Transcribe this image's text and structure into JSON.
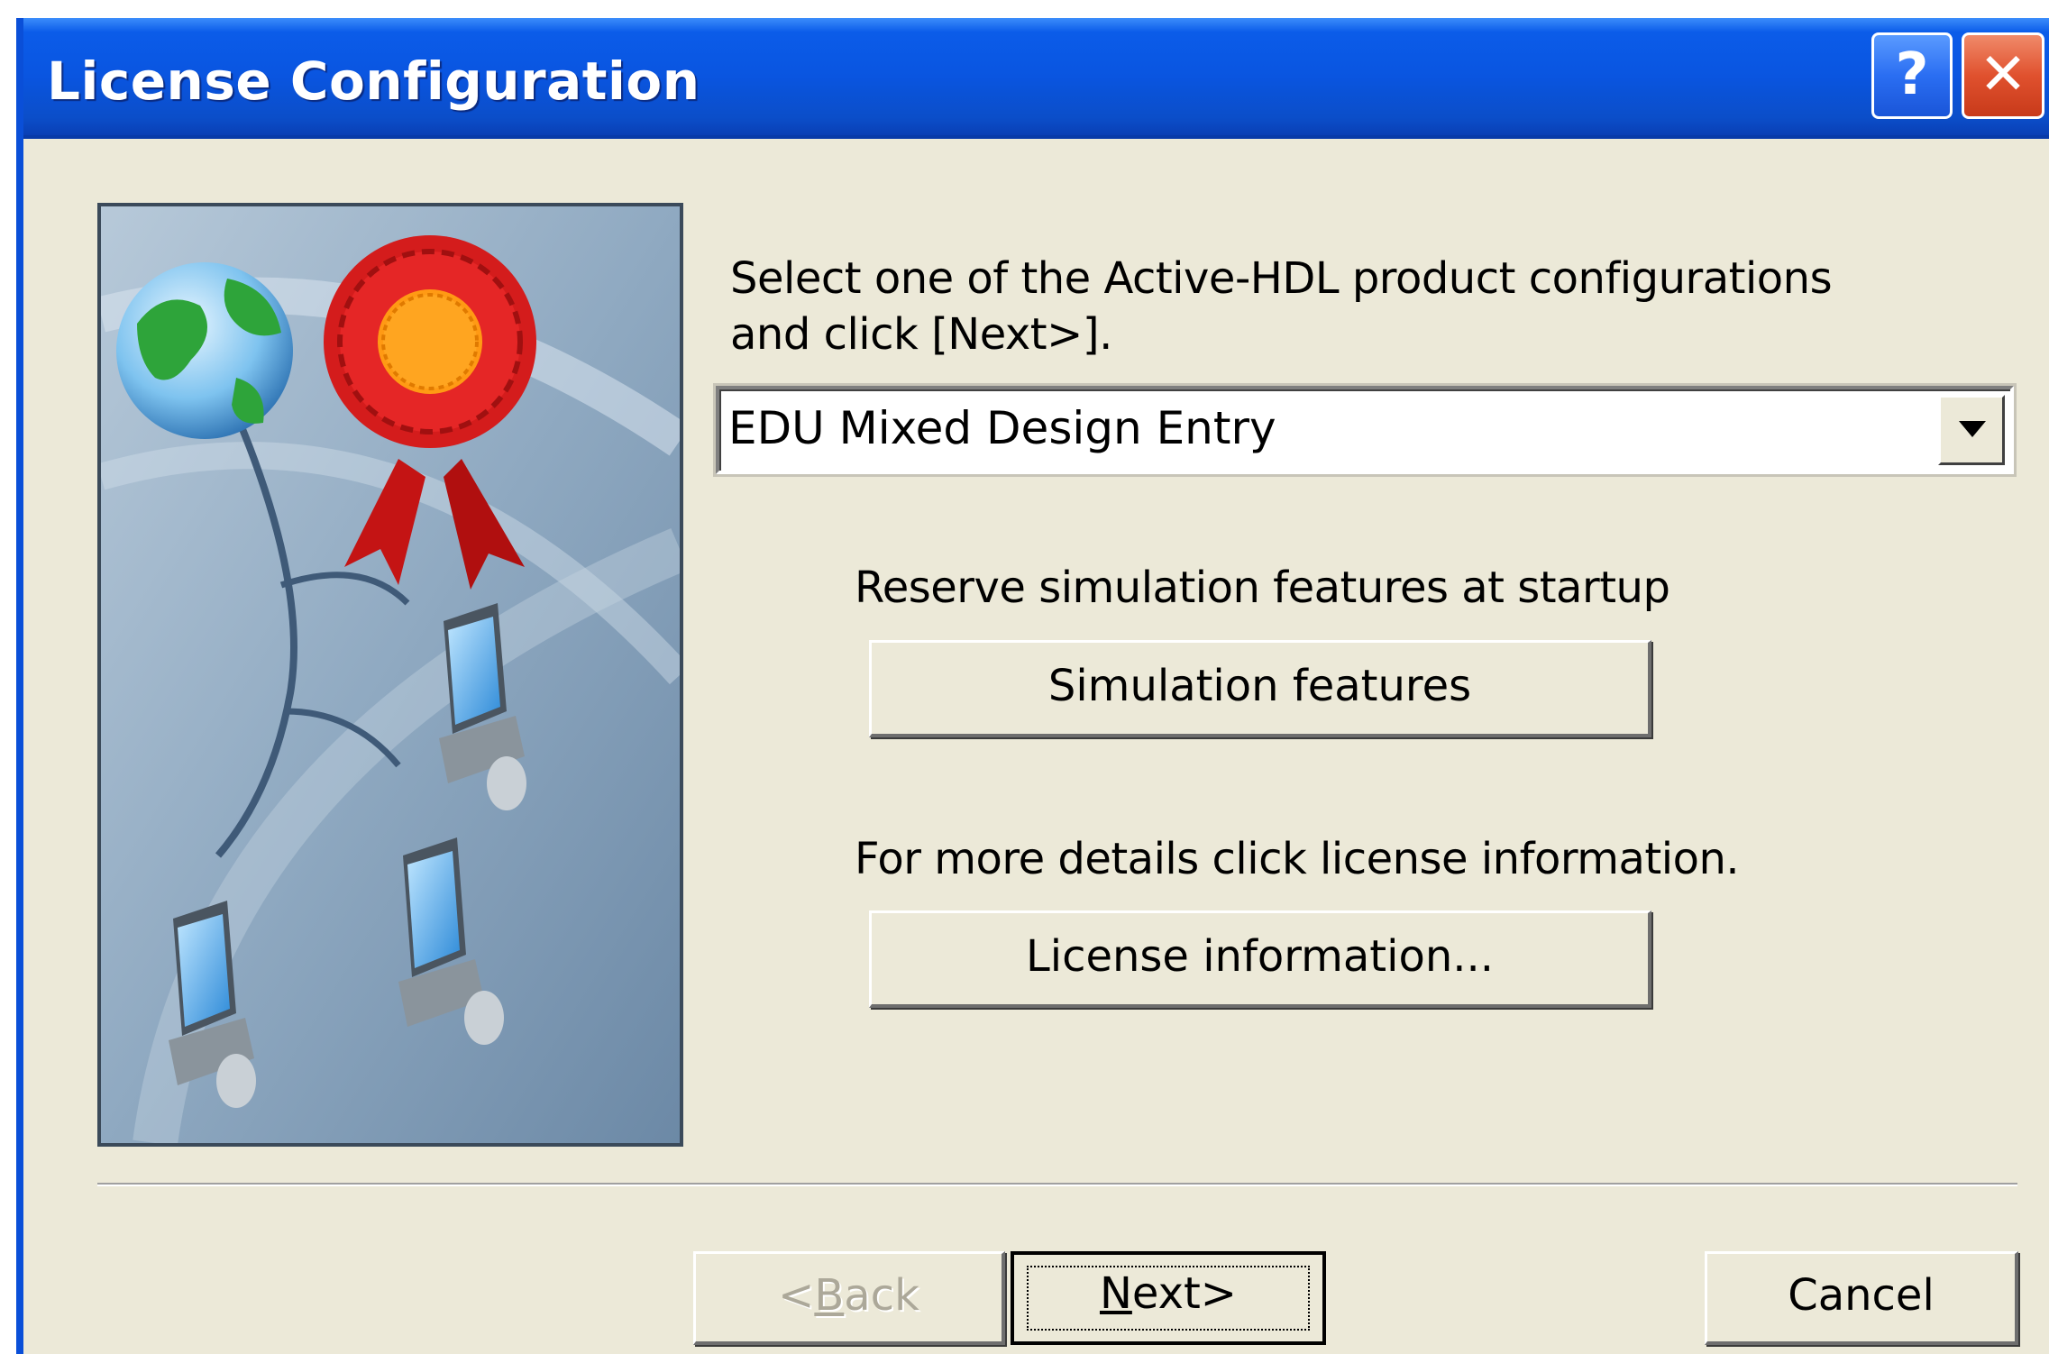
{
  "window": {
    "title": "License Configuration",
    "help_label": "?",
    "close_label": "✕"
  },
  "content": {
    "instruction": "Select one of the Active-HDL product configurations and click [Next>].",
    "configuration_select": {
      "selected": "EDU Mixed Design Entry"
    },
    "reserve_label": "Reserve simulation features at startup",
    "simulation_button": "Simulation features",
    "details_label": "For more details click license information.",
    "license_button": "License information..."
  },
  "footer": {
    "back_prefix": "<",
    "back_hotkey": "B",
    "back_rest": "ack",
    "next_hotkey": "N",
    "next_rest": "ext>",
    "cancel_label": "Cancel"
  },
  "colors": {
    "titlebar": "#0a55e0",
    "dialog_bg": "#ece9d8",
    "close_button": "#e0512e"
  },
  "icons": [
    "help-icon",
    "close-icon",
    "dropdown-arrow-icon",
    "globe-icon",
    "award-ribbon-icon",
    "computer-icon"
  ]
}
